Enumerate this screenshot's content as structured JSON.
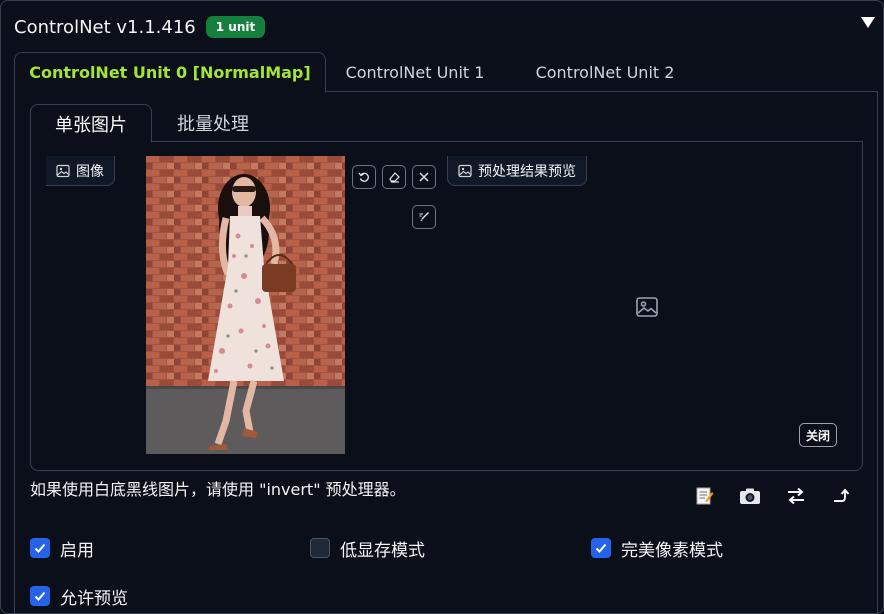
{
  "header": {
    "title": "ControlNet v1.1.416",
    "badge": "1 unit"
  },
  "outer_tabs": [
    {
      "label": "ControlNet Unit 0 [NormalMap]",
      "active": true
    },
    {
      "label": "ControlNet Unit 1",
      "active": false
    },
    {
      "label": "ControlNet Unit 2",
      "active": false
    }
  ],
  "inner_tabs": [
    {
      "label": "单张图片",
      "active": true
    },
    {
      "label": "批量处理",
      "active": false
    }
  ],
  "image_panel": {
    "input_label": "图像",
    "preview_label": "预处理结果预览",
    "close_label": "关闭"
  },
  "hint_text": "如果使用白底黑线图片，请使用 \"invert\" 预处理器。",
  "icons": {
    "edit": "memo-icon",
    "camera": "camera-icon",
    "swap": "swap-icon",
    "send": "send-dimensions-icon"
  },
  "checkboxes": [
    {
      "label": "启用",
      "checked": true
    },
    {
      "label": "低显存模式",
      "checked": false
    },
    {
      "label": "完美像素模式",
      "checked": true
    },
    {
      "label": "允许预览",
      "checked": true
    }
  ],
  "colors": {
    "accent": "#2563eb",
    "badge": "#15803d",
    "active_tab": "#a3e635",
    "background": "#0b0f19"
  }
}
